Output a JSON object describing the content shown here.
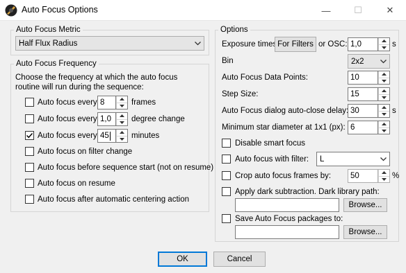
{
  "window": {
    "title": "Auto Focus Options",
    "min": "—",
    "max": "☐",
    "close": "✕"
  },
  "metric": {
    "title": "Auto Focus Metric",
    "selected": "Half Flux Radius"
  },
  "frequency": {
    "title": "Auto Focus Frequency",
    "description": "Choose the frequency at which the auto focus routine will run during the sequence:",
    "rows": [
      {
        "label": "Auto focus every",
        "checked": false,
        "value": "8",
        "unit": "frames"
      },
      {
        "label": "Auto focus every",
        "checked": false,
        "value": "1,0",
        "unit": "degree change"
      },
      {
        "label": "Auto focus every",
        "checked": true,
        "value": "45",
        "unit": "minutes"
      }
    ],
    "options": [
      {
        "label": "Auto focus on filter change",
        "checked": false
      },
      {
        "label": "Auto focus before sequence start (not on resume)",
        "checked": false
      },
      {
        "label": "Auto focus on resume",
        "checked": false
      },
      {
        "label": "Auto focus after automatic centering action",
        "checked": false
      }
    ]
  },
  "options": {
    "title": "Options",
    "exposure_label": "Exposure times:",
    "for_filters_button": "For Filters",
    "or_osc_label": "or OSC:",
    "exposure_value": "1,0",
    "exposure_unit": "s",
    "bin_label": "Bin",
    "bin_value": "2x2",
    "data_points_label": "Auto Focus Data Points:",
    "data_points_value": "10",
    "step_size_label": "Step Size:",
    "step_size_value": "15",
    "close_delay_label": "Auto Focus dialog auto-close delay:",
    "close_delay_value": "30",
    "close_delay_unit": "s",
    "min_star_label": "Minimum star diameter at 1x1 (px):",
    "min_star_value": "6",
    "disable_smart_label": "Disable smart focus",
    "af_filter_label": "Auto focus with filter:",
    "af_filter_value": "L",
    "crop_label": "Crop auto focus frames by:",
    "crop_value": "50",
    "crop_unit": "%",
    "dark_label": "Apply dark subtraction.  Dark library path:",
    "dark_path": "",
    "dark_browse": "Browse...",
    "save_label": "Save Auto Focus packages to:",
    "save_path": "",
    "save_browse": "Browse..."
  },
  "footer": {
    "ok": "OK",
    "cancel": "Cancel"
  }
}
